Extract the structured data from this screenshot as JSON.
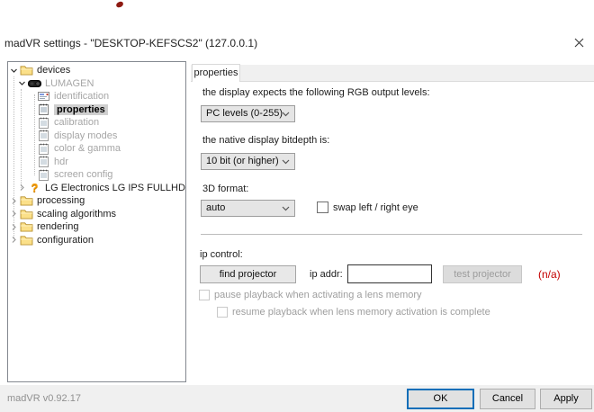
{
  "colors": {
    "accent_blue": "#0d6eb8",
    "selection_gray": "#cfcfcf",
    "na_red": "#c40000",
    "disabled_text": "#9e9e9e",
    "folder_yellow": "#fbe089",
    "tabstrip_gray": "#f0f0f0"
  },
  "window": {
    "title": "madVR settings - \"DESKTOP-KEFSCS2\"  (127.0.0.1)",
    "close_icon": "close-x"
  },
  "tree": {
    "items": [
      {
        "label": "devices",
        "icon": "folder-icon",
        "state": "expanded",
        "level": 0
      },
      {
        "label": "LUMAGEN",
        "icon": "device-icon",
        "state": "expanded",
        "level": 1,
        "dimmed": true
      },
      {
        "label": "identification",
        "icon": "id-card-icon",
        "level": 2,
        "dimmed": true
      },
      {
        "label": "properties",
        "icon": "page-icon",
        "level": 2,
        "selected": true
      },
      {
        "label": "calibration",
        "icon": "page-icon",
        "level": 2,
        "dimmed": true
      },
      {
        "label": "display modes",
        "icon": "page-icon",
        "level": 2,
        "dimmed": true
      },
      {
        "label": "color & gamma",
        "icon": "page-icon",
        "level": 2,
        "dimmed": true
      },
      {
        "label": "hdr",
        "icon": "page-icon",
        "level": 2,
        "dimmed": true
      },
      {
        "label": "screen config",
        "icon": "page-icon",
        "level": 2,
        "dimmed": true
      },
      {
        "label": "LG Electronics LG IPS FULLHD",
        "icon": "question-icon",
        "state": "collapsed",
        "level": 1
      },
      {
        "label": "processing",
        "icon": "folder-icon",
        "state": "collapsed",
        "level": 0
      },
      {
        "label": "scaling algorithms",
        "icon": "folder-icon",
        "state": "collapsed",
        "level": 0
      },
      {
        "label": "rendering",
        "icon": "folder-icon",
        "state": "collapsed",
        "level": 0
      },
      {
        "label": "configuration",
        "icon": "folder-icon",
        "state": "collapsed",
        "level": 0
      }
    ]
  },
  "main": {
    "tab_label": "properties",
    "rgb_label": "the display expects the following RGB output levels:",
    "rgb_value": "PC levels (0-255)",
    "bitdepth_label": "the native display bitdepth is:",
    "bitdepth_value": "10 bit (or higher)",
    "format3d_label": "3D format:",
    "format3d_value": "auto",
    "swap_label": "swap left / right eye",
    "swap_checked": false,
    "ip_section_label": "ip control:",
    "find_button": "find projector",
    "ipaddr_label": "ip addr:",
    "ip_value": "",
    "test_button": "test projector",
    "test_button_enabled": false,
    "na_text": "(n/a)",
    "pause_label": "pause playback when activating a lens memory",
    "pause_checked": false,
    "resume_label": "resume playback when lens memory activation is complete",
    "resume_checked": false
  },
  "footer": {
    "version": "madVR v0.92.17",
    "ok": "OK",
    "cancel": "Cancel",
    "apply": "Apply"
  }
}
